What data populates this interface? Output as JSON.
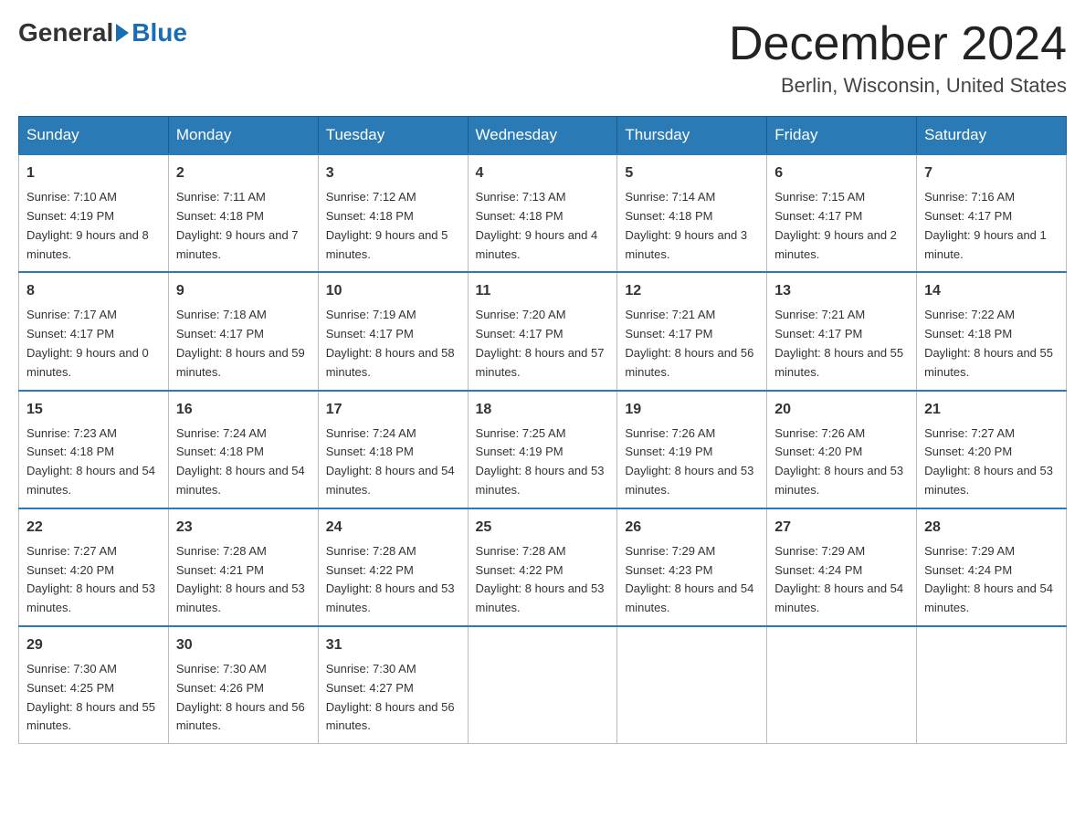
{
  "header": {
    "logo": {
      "general": "General",
      "blue": "Blue"
    },
    "title": "December 2024",
    "location": "Berlin, Wisconsin, United States"
  },
  "weekdays": [
    "Sunday",
    "Monday",
    "Tuesday",
    "Wednesday",
    "Thursday",
    "Friday",
    "Saturday"
  ],
  "weeks": [
    [
      {
        "day": "1",
        "sunrise": "7:10 AM",
        "sunset": "4:19 PM",
        "daylight": "9 hours and 8 minutes."
      },
      {
        "day": "2",
        "sunrise": "7:11 AM",
        "sunset": "4:18 PM",
        "daylight": "9 hours and 7 minutes."
      },
      {
        "day": "3",
        "sunrise": "7:12 AM",
        "sunset": "4:18 PM",
        "daylight": "9 hours and 5 minutes."
      },
      {
        "day": "4",
        "sunrise": "7:13 AM",
        "sunset": "4:18 PM",
        "daylight": "9 hours and 4 minutes."
      },
      {
        "day": "5",
        "sunrise": "7:14 AM",
        "sunset": "4:18 PM",
        "daylight": "9 hours and 3 minutes."
      },
      {
        "day": "6",
        "sunrise": "7:15 AM",
        "sunset": "4:17 PM",
        "daylight": "9 hours and 2 minutes."
      },
      {
        "day": "7",
        "sunrise": "7:16 AM",
        "sunset": "4:17 PM",
        "daylight": "9 hours and 1 minute."
      }
    ],
    [
      {
        "day": "8",
        "sunrise": "7:17 AM",
        "sunset": "4:17 PM",
        "daylight": "9 hours and 0 minutes."
      },
      {
        "day": "9",
        "sunrise": "7:18 AM",
        "sunset": "4:17 PM",
        "daylight": "8 hours and 59 minutes."
      },
      {
        "day": "10",
        "sunrise": "7:19 AM",
        "sunset": "4:17 PM",
        "daylight": "8 hours and 58 minutes."
      },
      {
        "day": "11",
        "sunrise": "7:20 AM",
        "sunset": "4:17 PM",
        "daylight": "8 hours and 57 minutes."
      },
      {
        "day": "12",
        "sunrise": "7:21 AM",
        "sunset": "4:17 PM",
        "daylight": "8 hours and 56 minutes."
      },
      {
        "day": "13",
        "sunrise": "7:21 AM",
        "sunset": "4:17 PM",
        "daylight": "8 hours and 55 minutes."
      },
      {
        "day": "14",
        "sunrise": "7:22 AM",
        "sunset": "4:18 PM",
        "daylight": "8 hours and 55 minutes."
      }
    ],
    [
      {
        "day": "15",
        "sunrise": "7:23 AM",
        "sunset": "4:18 PM",
        "daylight": "8 hours and 54 minutes."
      },
      {
        "day": "16",
        "sunrise": "7:24 AM",
        "sunset": "4:18 PM",
        "daylight": "8 hours and 54 minutes."
      },
      {
        "day": "17",
        "sunrise": "7:24 AM",
        "sunset": "4:18 PM",
        "daylight": "8 hours and 54 minutes."
      },
      {
        "day": "18",
        "sunrise": "7:25 AM",
        "sunset": "4:19 PM",
        "daylight": "8 hours and 53 minutes."
      },
      {
        "day": "19",
        "sunrise": "7:26 AM",
        "sunset": "4:19 PM",
        "daylight": "8 hours and 53 minutes."
      },
      {
        "day": "20",
        "sunrise": "7:26 AM",
        "sunset": "4:20 PM",
        "daylight": "8 hours and 53 minutes."
      },
      {
        "day": "21",
        "sunrise": "7:27 AM",
        "sunset": "4:20 PM",
        "daylight": "8 hours and 53 minutes."
      }
    ],
    [
      {
        "day": "22",
        "sunrise": "7:27 AM",
        "sunset": "4:20 PM",
        "daylight": "8 hours and 53 minutes."
      },
      {
        "day": "23",
        "sunrise": "7:28 AM",
        "sunset": "4:21 PM",
        "daylight": "8 hours and 53 minutes."
      },
      {
        "day": "24",
        "sunrise": "7:28 AM",
        "sunset": "4:22 PM",
        "daylight": "8 hours and 53 minutes."
      },
      {
        "day": "25",
        "sunrise": "7:28 AM",
        "sunset": "4:22 PM",
        "daylight": "8 hours and 53 minutes."
      },
      {
        "day": "26",
        "sunrise": "7:29 AM",
        "sunset": "4:23 PM",
        "daylight": "8 hours and 54 minutes."
      },
      {
        "day": "27",
        "sunrise": "7:29 AM",
        "sunset": "4:24 PM",
        "daylight": "8 hours and 54 minutes."
      },
      {
        "day": "28",
        "sunrise": "7:29 AM",
        "sunset": "4:24 PM",
        "daylight": "8 hours and 54 minutes."
      }
    ],
    [
      {
        "day": "29",
        "sunrise": "7:30 AM",
        "sunset": "4:25 PM",
        "daylight": "8 hours and 55 minutes."
      },
      {
        "day": "30",
        "sunrise": "7:30 AM",
        "sunset": "4:26 PM",
        "daylight": "8 hours and 56 minutes."
      },
      {
        "day": "31",
        "sunrise": "7:30 AM",
        "sunset": "4:27 PM",
        "daylight": "8 hours and 56 minutes."
      },
      null,
      null,
      null,
      null
    ]
  ],
  "labels": {
    "sunrise": "Sunrise:",
    "sunset": "Sunset:",
    "daylight": "Daylight:"
  }
}
